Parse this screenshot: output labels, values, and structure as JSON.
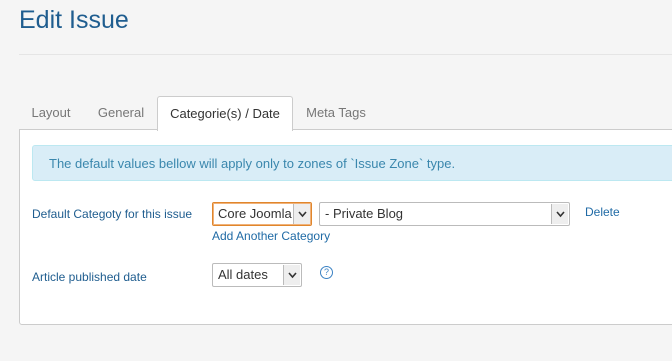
{
  "page": {
    "title": "Edit Issue"
  },
  "tabs": [
    {
      "label": "Layout"
    },
    {
      "label": "General"
    },
    {
      "label": "Categorie(s) / Date"
    },
    {
      "label": "Meta Tags"
    }
  ],
  "active_tab": "Categorie(s) / Date",
  "alert": {
    "text": "The default values bellow will apply only to zones of `Issue Zone` type."
  },
  "category": {
    "label": "Default Categoty for this issue",
    "site_value": "Core Joomla",
    "category_value": "- Private Blog",
    "delete_label": "Delete",
    "add_label": "Add Another Category"
  },
  "published": {
    "label": "Article published date",
    "value": "All dates",
    "help_glyph": "?"
  },
  "icons": {
    "dropdown": "chevron-down-icon",
    "help": "help-circle-icon"
  },
  "colors": {
    "title": "#1f5d8f",
    "link": "#1f6aa5",
    "alert_bg": "#d9edf7",
    "focus": "#e0862c"
  }
}
